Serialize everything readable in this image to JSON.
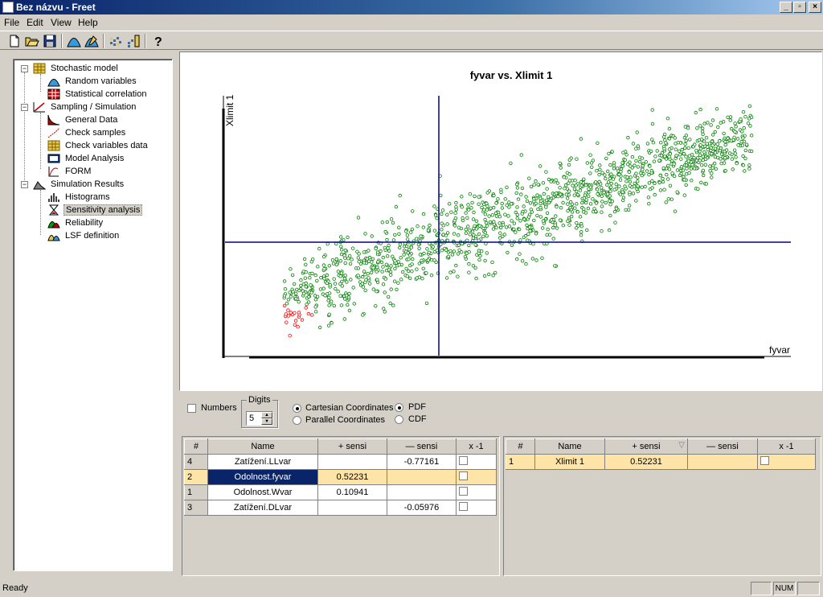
{
  "window": {
    "title": "Bez názvu - Freet"
  },
  "menu": [
    "File",
    "Edit",
    "View",
    "Help"
  ],
  "toolbar": {
    "icons": [
      "new-file-icon",
      "open-folder-icon",
      "save-icon",
      "distribution-icon",
      "distribution-edit-icon",
      "samples-icon",
      "samples-edit-icon",
      "help-icon"
    ]
  },
  "tree": {
    "groups": [
      {
        "label": "Stochastic model",
        "icon": "grid-icon",
        "children": [
          {
            "label": "Random variables",
            "icon": "distribution-icon"
          },
          {
            "label": "Statistical correlation",
            "icon": "correlation-matrix-icon"
          }
        ]
      },
      {
        "label": "Sampling / Simulation",
        "icon": "sampling-icon",
        "children": [
          {
            "label": "General Data",
            "icon": "general-data-icon"
          },
          {
            "label": "Check samples",
            "icon": "check-samples-icon"
          },
          {
            "label": "Check variables data",
            "icon": "grid-icon"
          },
          {
            "label": "Model Analysis",
            "icon": "model-analysis-icon"
          },
          {
            "label": "FORM",
            "icon": "form-icon"
          }
        ]
      },
      {
        "label": "Simulation Results",
        "icon": "results-icon",
        "children": [
          {
            "label": "Histograms",
            "icon": "histogram-icon"
          },
          {
            "label": "Sensitivity analysis",
            "icon": "hourglass-icon",
            "selected": true
          },
          {
            "label": "Reliability",
            "icon": "reliability-icon"
          },
          {
            "label": "LSF definition",
            "icon": "lsf-icon"
          }
        ]
      }
    ]
  },
  "chart_data": {
    "type": "scatter",
    "title": "fyvar vs. Xlimit 1",
    "xlabel": "fyvar",
    "ylabel": "Xlimit 1",
    "point_color": "#008000",
    "failure_point_color": "#ff0000",
    "axis_color": "#00008b",
    "trend": {
      "slope": 0.52231,
      "x_range": [
        -3.5,
        4.4
      ],
      "spread_base": 0.9
    },
    "grid": false
  },
  "controls": {
    "numbers_label": "Numbers",
    "digits_label": "Digits",
    "digits_value": "5",
    "cartesian_label": "Cartesian Coordinates",
    "parallel_label": "Parallel Coordinates",
    "pdf_label": "PDF",
    "cdf_label": "CDF"
  },
  "left_table": {
    "headers": [
      "#",
      "Name",
      "+ sensi",
      "— sensi",
      "x -1"
    ],
    "rows": [
      {
        "idx": "4",
        "name": "Zatížení.LLvar",
        "plus": "",
        "minus": "-0.77161"
      },
      {
        "idx": "2",
        "name": "Odolnost.fyvar",
        "plus": "0.52231",
        "minus": "",
        "highlight": true
      },
      {
        "idx": "1",
        "name": "Odolnost.Wvar",
        "plus": "0.10941",
        "minus": ""
      },
      {
        "idx": "3",
        "name": "Zatížení.DLvar",
        "plus": "",
        "minus": "-0.05976"
      }
    ]
  },
  "right_table": {
    "headers": [
      "#",
      "Name",
      "+ sensi",
      "— sensi",
      "x -1"
    ],
    "rows": [
      {
        "idx": "1",
        "name": "Xlimit 1",
        "plus": "0.52231",
        "minus": "",
        "highlight": true
      }
    ]
  },
  "status": {
    "text": "Ready",
    "num": "NUM"
  }
}
